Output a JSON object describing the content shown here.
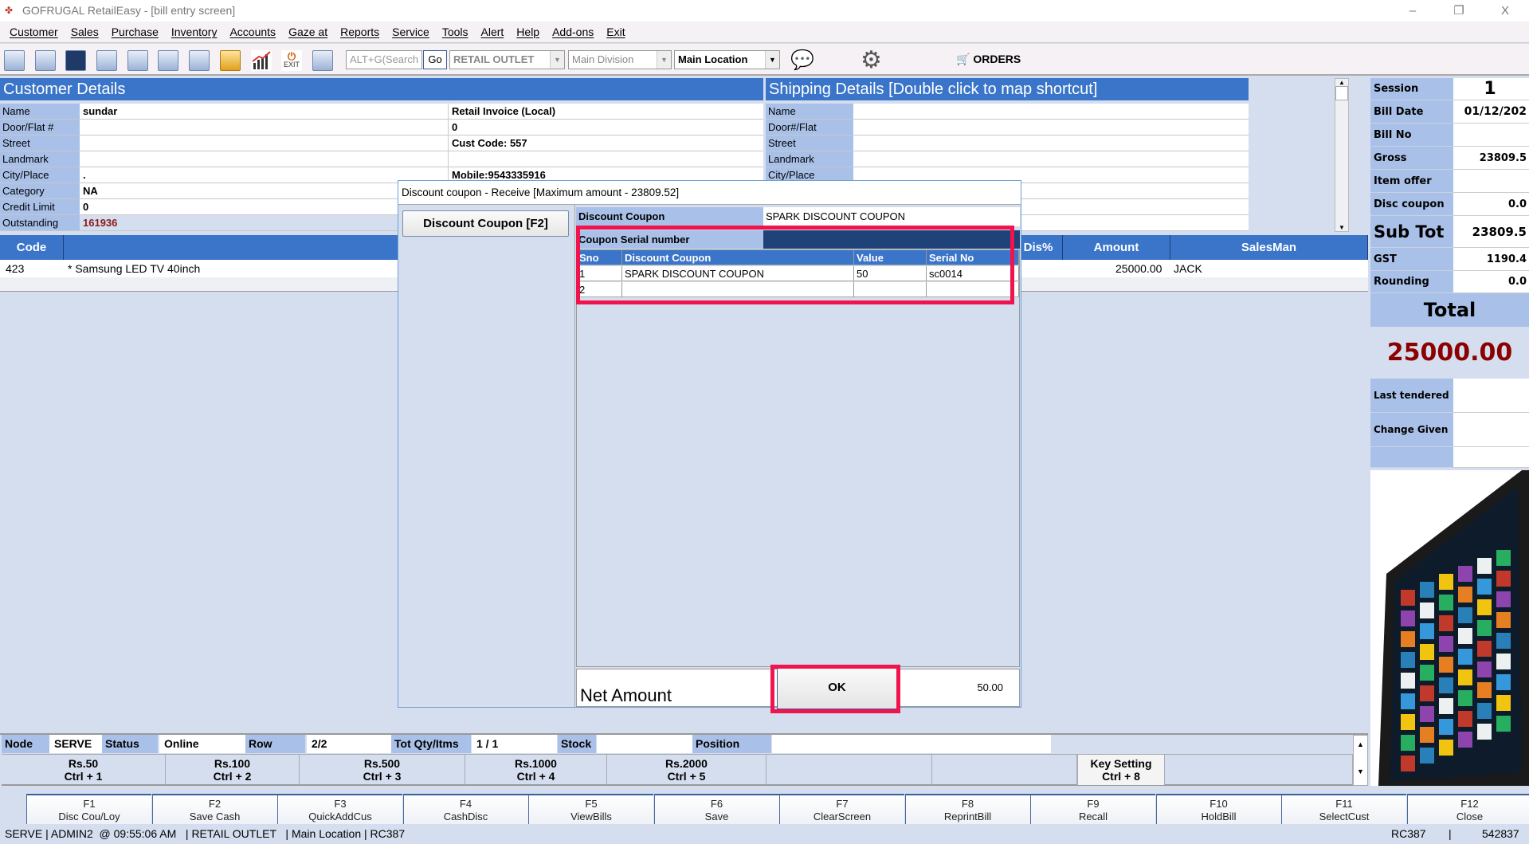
{
  "window": {
    "title": "GOFRUGAL RetailEasy - [bill entry screen]",
    "minimize": "–",
    "restore": "❐",
    "close": "X"
  },
  "menu": [
    "Customer",
    "Sales",
    "Purchase",
    "Inventory",
    "Accounts",
    "Gaze at",
    "Reports",
    "Service",
    "Tools",
    "Alert",
    "Help",
    "Add-ons",
    "Exit"
  ],
  "toolbar": {
    "exit_label": "EXIT",
    "search_placeholder": "ALT+G(Search",
    "go_label": "Go",
    "outlet": "RETAIL OUTLET",
    "division": "Main Division",
    "location": "Main Location",
    "orders_label": "ORDERS"
  },
  "customer": {
    "header": "Customer Details",
    "fields": [
      {
        "label": "Name",
        "value": "sundar",
        "extra": "Retail Invoice (Local)"
      },
      {
        "label": "Door/Flat #",
        "value": "",
        "extra": "0"
      },
      {
        "label": "Street",
        "value": "",
        "extra": "Cust Code: 557"
      },
      {
        "label": "Landmark",
        "value": "",
        "extra": ""
      },
      {
        "label": "City/Place",
        "value": ".",
        "extra": "Mobile:9543335916"
      },
      {
        "label": "Category",
        "value": "NA",
        "extra": ""
      },
      {
        "label": "Credit Limit",
        "value": "0",
        "extra": ""
      },
      {
        "label": "Outstanding",
        "value": "161936",
        "extra": ""
      }
    ]
  },
  "shipping": {
    "header": "Shipping Details   [Double click to map shortcut]",
    "fields": [
      "Name",
      "Door#/Flat",
      "Street",
      "Landmark",
      "City/Place"
    ]
  },
  "grid": {
    "columns": {
      "code": "Code",
      "dis": "Dis%",
      "amount": "Amount",
      "salesman": "SalesMan"
    },
    "rows": [
      {
        "code": "423",
        "name": "* Samsung LED TV 40inch",
        "amount": "25000.00",
        "salesman": "JACK"
      }
    ]
  },
  "summary": {
    "session_label": "Session",
    "session": "1",
    "bill_date_label": "Bill Date",
    "bill_date": "01/12/202",
    "bill_no_label": "Bill No",
    "bill_no": "",
    "gross_label": "Gross",
    "gross": "23809.5",
    "item_offer_label": "Item offer",
    "item_offer": "",
    "disc_coupon_label": "Disc coupon",
    "disc_coupon": "0.0",
    "subtot_label": "Sub Tot",
    "subtot": "23809.5",
    "gst_label": "GST",
    "gst": "1190.4",
    "rounding_label": "Rounding",
    "rounding": "0.0",
    "total_label": "Total",
    "total": "25000.00",
    "last_tendered_label": "Last tendered",
    "change_given_label": "Change Given"
  },
  "dialog": {
    "title": "Discount coupon - Receive [Maximum amount - 23809.52]",
    "coupon_button": "Discount Coupon [F2]",
    "coupon_label": "Discount Coupon",
    "coupon_value": "SPARK DISCOUNT COUPON",
    "serial_label": "Coupon Serial number",
    "columns": {
      "sno": "Sno",
      "coupon": "Discount Coupon",
      "value": "Value",
      "serial": "Serial No"
    },
    "rows": [
      {
        "sno": "1",
        "coupon": "SPARK DISCOUNT COUPON",
        "value": "50",
        "serial": "sc0014"
      },
      {
        "sno": "2",
        "coupon": "",
        "value": "",
        "serial": ""
      }
    ],
    "net_amount_label": "Net Amount",
    "ok_label": "OK",
    "net_amount": "50.00"
  },
  "status": {
    "node_label": "Node",
    "node": "SERVE",
    "status_label": "Status",
    "status": "Online",
    "row_label": "Row",
    "row": "2/2",
    "totqty_label": "Tot Qty/Itms",
    "totqty": "1 / 1",
    "stock_label": "Stock",
    "stock": "",
    "position_label": "Position",
    "position": ""
  },
  "denominations": [
    {
      "l1": "Rs.50",
      "l2": "Ctrl + 1"
    },
    {
      "l1": "Rs.100",
      "l2": "Ctrl + 2"
    },
    {
      "l1": "Rs.500",
      "l2": "Ctrl + 3"
    },
    {
      "l1": "Rs.1000",
      "l2": "Ctrl + 4"
    },
    {
      "l1": "Rs.2000",
      "l2": "Ctrl + 5"
    }
  ],
  "key_setting": {
    "l1": "Key Setting",
    "l2": "Ctrl + 8"
  },
  "fkeys": [
    {
      "k": "F1",
      "l": "Disc Cou/Loy"
    },
    {
      "k": "F2",
      "l": "Save  Cash"
    },
    {
      "k": "F3",
      "l": "QuickAddCus"
    },
    {
      "k": "F4",
      "l": "CashDisc"
    },
    {
      "k": "F5",
      "l": "ViewBills"
    },
    {
      "k": "F6",
      "l": "Save"
    },
    {
      "k": "F7",
      "l": "ClearScreen"
    },
    {
      "k": "F8",
      "l": "ReprintBill"
    },
    {
      "k": "F9",
      "l": "Recall"
    },
    {
      "k": "F10",
      "l": "HoldBill"
    },
    {
      "k": "F11",
      "l": "SelectCust"
    },
    {
      "k": "F12",
      "l": "Close"
    }
  ],
  "footer": {
    "left": "SERVE | ADMIN2  @ 09:55:06 AM   | RETAIL OUTLET   | Main Location | RC387",
    "right_code": "RC387",
    "sep": "|",
    "right_num": "542837"
  }
}
